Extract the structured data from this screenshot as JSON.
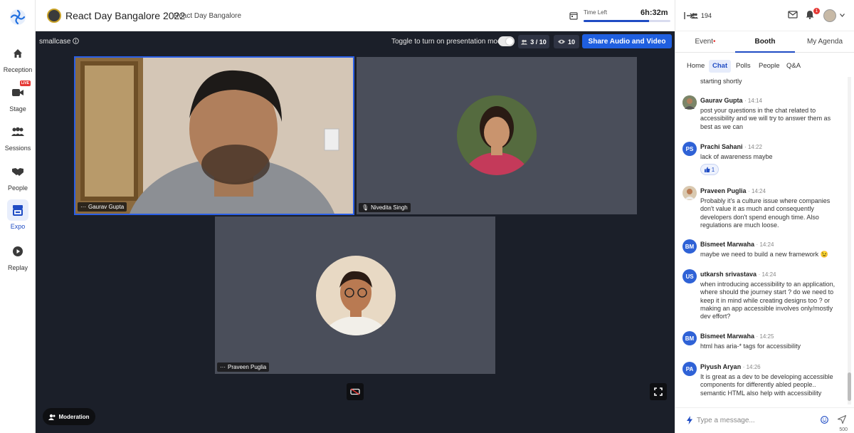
{
  "rail": {
    "items": [
      {
        "label": "Reception"
      },
      {
        "label": "Stage",
        "badge": "LIVE"
      },
      {
        "label": "Sessions"
      },
      {
        "label": "People"
      },
      {
        "label": "Expo",
        "active": true
      },
      {
        "label": "Replay"
      }
    ]
  },
  "header": {
    "title": "React Day Bangalore 2022",
    "subtitle": "React Day Bangalore",
    "time_left_label": "Time Left",
    "time_left_value": "6h:32m",
    "time_progress": 0.75
  },
  "stage": {
    "org_name": "smallcase",
    "toggle_label": "Toggle to turn on presentation mode",
    "participants": "3 / 10",
    "viewers": "10",
    "share_button": "Share Audio and Video",
    "moderation_button": "Moderation",
    "tiles": [
      {
        "name": "Gaurav Gupta",
        "active": true
      },
      {
        "name": "Nivedita Singh"
      },
      {
        "name": "Praveen Puglia"
      }
    ]
  },
  "panel": {
    "attendee_count": "194",
    "notification_count": "1",
    "tabs": [
      "Event",
      "Booth",
      "My Agenda"
    ],
    "active_tab": "Booth",
    "subtabs": [
      "Home",
      "Chat",
      "Polls",
      "People",
      "Q&A"
    ],
    "active_subtab": "Chat",
    "partial_text": "starting shortly",
    "messages": [
      {
        "name": "Gaurav Gupta",
        "time": "14:14",
        "text": "post your questions in the chat related to accessibility and we will try to answer them as best as we can",
        "avatar": "photo"
      },
      {
        "name": "Prachi Sahani",
        "time": "14:22",
        "text": "lack of awareness maybe",
        "initials": "PS",
        "reaction": "1"
      },
      {
        "name": "Praveen Puglia",
        "time": "14:24",
        "text": "Probably it's a culture issue where companies don't value it as much and consequently developers don't spend enough time. Also regulations are much loose.",
        "avatar": "photo"
      },
      {
        "name": "Bismeet Marwaha",
        "time": "14:24",
        "text": "maybe we need to build a new framework 😉",
        "initials": "BM"
      },
      {
        "name": "utkarsh srivastava",
        "time": "14:24",
        "text": "when introducing accessibility to an application, where should the journey start ? do we need to keep it in mind while creating designs too ? or making an app accessible involves only/mostly dev effort?",
        "initials": "US"
      },
      {
        "name": "Bismeet Marwaha",
        "time": "14:25",
        "text": "html has aria-* tags for accessibility",
        "initials": "BM"
      },
      {
        "name": "Piyush Aryan",
        "time": "14:26",
        "text": "It is great as a dev to be developing accessible components for differently abled people.. semantic HTML also help with accessibility",
        "initials": "PA"
      }
    ],
    "composer_placeholder": "Type a message...",
    "char_limit": "500"
  },
  "colors": {
    "accent": "#1f4cc4",
    "stage_bg": "#1b1f29",
    "tile_bg": "#4a4e5a",
    "avatar_blue": "#2f62d6"
  }
}
